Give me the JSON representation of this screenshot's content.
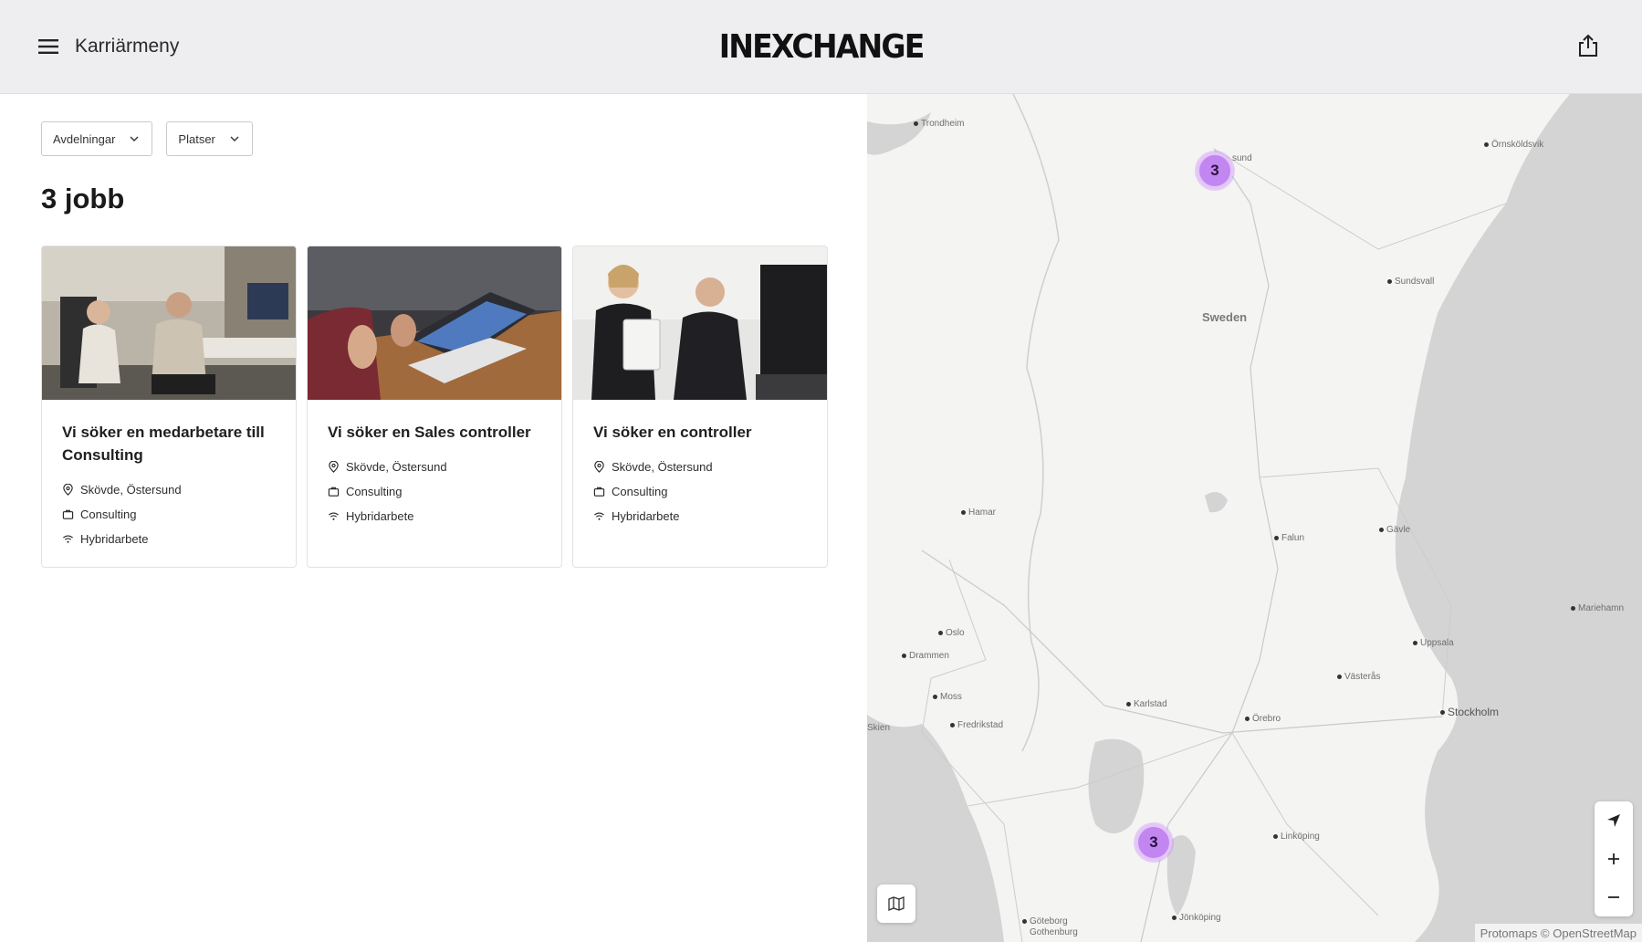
{
  "header": {
    "menu_label": "Karriärmeny",
    "logo_text": "INEXCHANGE",
    "menu_icon": "hamburger-icon",
    "share_icon": "share-icon"
  },
  "filters": {
    "departments": "Avdelningar",
    "locations": "Platser"
  },
  "job_count": "3 jobb",
  "jobs": [
    {
      "title": "Vi söker en medarbetare till Consulting",
      "location": "Skövde, Östersund",
      "department": "Consulting",
      "workplace": "Hybridarbete"
    },
    {
      "title": "Vi söker en Sales controller",
      "location": "Skövde, Östersund",
      "department": "Consulting",
      "workplace": "Hybridarbete"
    },
    {
      "title": "Vi söker en controller",
      "location": "Skövde, Östersund",
      "department": "Consulting",
      "workplace": "Hybridarbete"
    }
  ],
  "map": {
    "country_label": "Sweden",
    "clusters": [
      "3",
      "3"
    ],
    "cities": [
      "Trondheim",
      "Örnsköldsvik",
      "sund",
      "Sundsvall",
      "Hamar",
      "Falun",
      "Gävle",
      "Mariehamn",
      "Oslo",
      "Drammen",
      "Uppsala",
      "Västerås",
      "Moss",
      "Karlstad",
      "Fredrikstad",
      "Örebro",
      "Stockholm",
      "Skien",
      "Linköping",
      "Jönköping",
      "Göteborg",
      "Gothenburg"
    ],
    "attribution": "Protomaps © OpenStreetMap",
    "cluster_color": "#c286f0"
  }
}
